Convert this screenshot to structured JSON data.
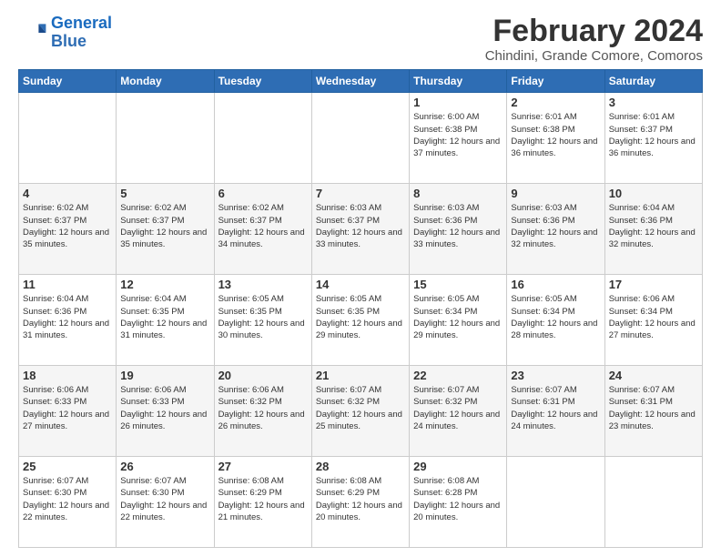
{
  "logo": {
    "line1": "General",
    "line2": "Blue"
  },
  "title": "February 2024",
  "subtitle": "Chindini, Grande Comore, Comoros",
  "weekdays": [
    "Sunday",
    "Monday",
    "Tuesday",
    "Wednesday",
    "Thursday",
    "Friday",
    "Saturday"
  ],
  "weeks": [
    [
      {
        "day": "",
        "info": ""
      },
      {
        "day": "",
        "info": ""
      },
      {
        "day": "",
        "info": ""
      },
      {
        "day": "",
        "info": ""
      },
      {
        "day": "1",
        "info": "Sunrise: 6:00 AM\nSunset: 6:38 PM\nDaylight: 12 hours\nand 37 minutes."
      },
      {
        "day": "2",
        "info": "Sunrise: 6:01 AM\nSunset: 6:38 PM\nDaylight: 12 hours\nand 36 minutes."
      },
      {
        "day": "3",
        "info": "Sunrise: 6:01 AM\nSunset: 6:37 PM\nDaylight: 12 hours\nand 36 minutes."
      }
    ],
    [
      {
        "day": "4",
        "info": "Sunrise: 6:02 AM\nSunset: 6:37 PM\nDaylight: 12 hours\nand 35 minutes."
      },
      {
        "day": "5",
        "info": "Sunrise: 6:02 AM\nSunset: 6:37 PM\nDaylight: 12 hours\nand 35 minutes."
      },
      {
        "day": "6",
        "info": "Sunrise: 6:02 AM\nSunset: 6:37 PM\nDaylight: 12 hours\nand 34 minutes."
      },
      {
        "day": "7",
        "info": "Sunrise: 6:03 AM\nSunset: 6:37 PM\nDaylight: 12 hours\nand 33 minutes."
      },
      {
        "day": "8",
        "info": "Sunrise: 6:03 AM\nSunset: 6:36 PM\nDaylight: 12 hours\nand 33 minutes."
      },
      {
        "day": "9",
        "info": "Sunrise: 6:03 AM\nSunset: 6:36 PM\nDaylight: 12 hours\nand 32 minutes."
      },
      {
        "day": "10",
        "info": "Sunrise: 6:04 AM\nSunset: 6:36 PM\nDaylight: 12 hours\nand 32 minutes."
      }
    ],
    [
      {
        "day": "11",
        "info": "Sunrise: 6:04 AM\nSunset: 6:36 PM\nDaylight: 12 hours\nand 31 minutes."
      },
      {
        "day": "12",
        "info": "Sunrise: 6:04 AM\nSunset: 6:35 PM\nDaylight: 12 hours\nand 31 minutes."
      },
      {
        "day": "13",
        "info": "Sunrise: 6:05 AM\nSunset: 6:35 PM\nDaylight: 12 hours\nand 30 minutes."
      },
      {
        "day": "14",
        "info": "Sunrise: 6:05 AM\nSunset: 6:35 PM\nDaylight: 12 hours\nand 29 minutes."
      },
      {
        "day": "15",
        "info": "Sunrise: 6:05 AM\nSunset: 6:34 PM\nDaylight: 12 hours\nand 29 minutes."
      },
      {
        "day": "16",
        "info": "Sunrise: 6:05 AM\nSunset: 6:34 PM\nDaylight: 12 hours\nand 28 minutes."
      },
      {
        "day": "17",
        "info": "Sunrise: 6:06 AM\nSunset: 6:34 PM\nDaylight: 12 hours\nand 27 minutes."
      }
    ],
    [
      {
        "day": "18",
        "info": "Sunrise: 6:06 AM\nSunset: 6:33 PM\nDaylight: 12 hours\nand 27 minutes."
      },
      {
        "day": "19",
        "info": "Sunrise: 6:06 AM\nSunset: 6:33 PM\nDaylight: 12 hours\nand 26 minutes."
      },
      {
        "day": "20",
        "info": "Sunrise: 6:06 AM\nSunset: 6:32 PM\nDaylight: 12 hours\nand 26 minutes."
      },
      {
        "day": "21",
        "info": "Sunrise: 6:07 AM\nSunset: 6:32 PM\nDaylight: 12 hours\nand 25 minutes."
      },
      {
        "day": "22",
        "info": "Sunrise: 6:07 AM\nSunset: 6:32 PM\nDaylight: 12 hours\nand 24 minutes."
      },
      {
        "day": "23",
        "info": "Sunrise: 6:07 AM\nSunset: 6:31 PM\nDaylight: 12 hours\nand 24 minutes."
      },
      {
        "day": "24",
        "info": "Sunrise: 6:07 AM\nSunset: 6:31 PM\nDaylight: 12 hours\nand 23 minutes."
      }
    ],
    [
      {
        "day": "25",
        "info": "Sunrise: 6:07 AM\nSunset: 6:30 PM\nDaylight: 12 hours\nand 22 minutes."
      },
      {
        "day": "26",
        "info": "Sunrise: 6:07 AM\nSunset: 6:30 PM\nDaylight: 12 hours\nand 22 minutes."
      },
      {
        "day": "27",
        "info": "Sunrise: 6:08 AM\nSunset: 6:29 PM\nDaylight: 12 hours\nand 21 minutes."
      },
      {
        "day": "28",
        "info": "Sunrise: 6:08 AM\nSunset: 6:29 PM\nDaylight: 12 hours\nand 20 minutes."
      },
      {
        "day": "29",
        "info": "Sunrise: 6:08 AM\nSunset: 6:28 PM\nDaylight: 12 hours\nand 20 minutes."
      },
      {
        "day": "",
        "info": ""
      },
      {
        "day": "",
        "info": ""
      }
    ]
  ]
}
